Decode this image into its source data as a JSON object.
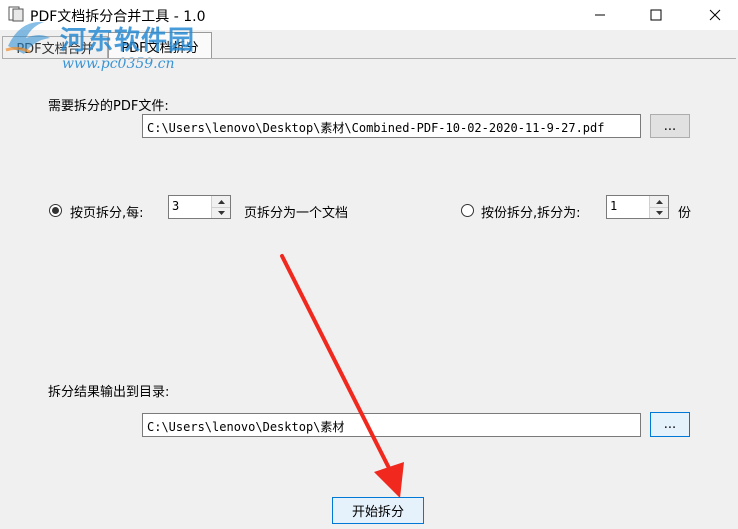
{
  "window": {
    "title": "PDF文档拆分合并工具 - 1.0"
  },
  "tabs": [
    {
      "label": "PDF文档合并"
    },
    {
      "label": "PDF文档拆分"
    }
  ],
  "watermark": {
    "text": "河东软件园",
    "url": "www.pc0359.cn"
  },
  "input": {
    "label": "需要拆分的PDF文件:",
    "path": "C:\\Users\\lenovo\\Desktop\\素材\\Combined-PDF-10-02-2020-11-9-27.pdf",
    "browse_label": "..."
  },
  "options": {
    "by_page_label": "按页拆分,每:",
    "by_page_value": "3",
    "by_page_suffix": "页拆分为一个文档",
    "by_copies_label": "按份拆分,拆分为:",
    "by_copies_value": "1",
    "by_copies_suffix": "份",
    "selected": "by_page"
  },
  "output": {
    "label": "拆分结果输出到目录:",
    "path": "C:\\Users\\lenovo\\Desktop\\素材",
    "browse_label": "..."
  },
  "actions": {
    "start_label": "开始拆分"
  },
  "colors": {
    "accent": "#0078d7",
    "annotation_arrow": "#f0281e",
    "watermark": "#278ad2"
  }
}
